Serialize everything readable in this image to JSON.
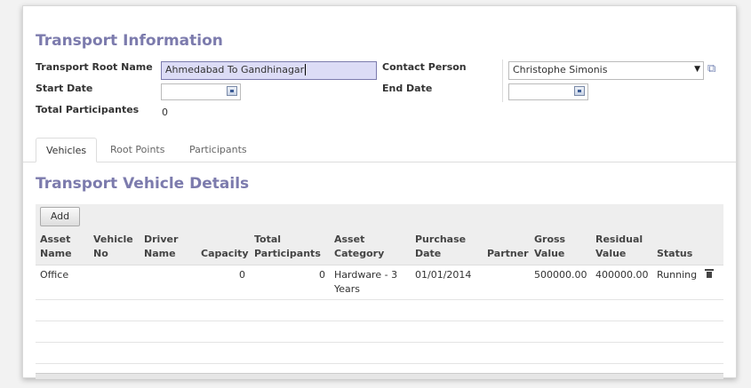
{
  "form": {
    "title": "Transport Information",
    "root_name_label": "Transport Root Name",
    "root_name_value": "Ahmedabad To Gandhinagar",
    "start_date_label": "Start Date",
    "start_date_value": "",
    "total_participants_label": "Total Participantes",
    "total_participants_value": "0",
    "contact_person_label": "Contact Person",
    "contact_person_value": "Christophe Simonis",
    "end_date_label": "End Date",
    "end_date_value": ""
  },
  "tabs": [
    {
      "label": "Vehicles",
      "active": true
    },
    {
      "label": "Root Points",
      "active": false
    },
    {
      "label": "Participants",
      "active": false
    }
  ],
  "vehicles": {
    "section_title": "Transport Vehicle Details",
    "add_label": "Add",
    "columns": [
      "Asset Name",
      "Vehicle No",
      "Driver Name",
      "Capacity",
      "Total Participants",
      "Asset Category",
      "Purchase Date",
      "Partner",
      "Gross Value",
      "Residual Value",
      "Status"
    ],
    "rows": [
      {
        "asset_name": "Office",
        "vehicle_no": "",
        "driver_name": "",
        "capacity": "0",
        "total_participants": "0",
        "asset_category": "Hardware - 3 Years",
        "purchase_date": "01/01/2014",
        "partner": "",
        "gross_value": "500000.00",
        "residual_value": "400000.00",
        "status": "Running"
      }
    ]
  },
  "icons": {
    "calendar": "calendar-icon",
    "external_link": "external-link-icon",
    "dropdown": "chevron-down-icon",
    "delete": "trash-icon"
  }
}
